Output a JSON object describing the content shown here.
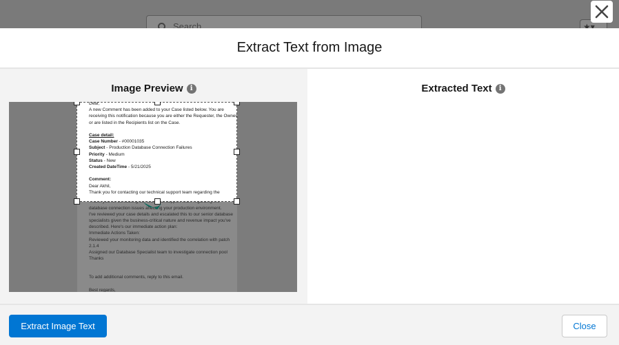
{
  "background": {
    "search_placeholder": "Search",
    "favorites_glyph": "★▾"
  },
  "modal": {
    "title": "Extract Text from Image",
    "close_icon": "close-icon",
    "left_pane": {
      "title": "Image Preview"
    },
    "right_pane": {
      "title": "Extracted Text",
      "content": ""
    },
    "info_glyph": "i",
    "footer": {
      "extract_button": "Extract Image Text",
      "close_button": "Close"
    }
  },
  "document": {
    "lines": [
      "Dear,",
      "A new Comment has been added to your Case listed below. You are",
      "receiving this notification because you are either the Requester, the Owner,",
      "or are listed in the Recipients list on the Case.",
      "",
      "Case detail:",
      "Case Number - #00001035",
      "Subject - Production Database Connection Failures",
      "Priority - Medium",
      "Status - New",
      "Created DateTime - 5/21/2025",
      "",
      "Comment:",
      "Dear Akhil,",
      "Thank you for contacting our technical support team regarding the",
      "database connection issues affecting your production environment.",
      "I've reviewed your case details and escalated this to our senior database",
      "specialists given the business-critical nature and revenue impact you've",
      "described. Here's our immediate action plan:",
      "Immediate Actions Taken:",
      "Reviewed your monitoring data and identified the correlation with patch",
      "2.1.4",
      "Assigned our Database Specialist team to investigate connection pool",
      "Thanks",
      "",
      "",
      "To add additional comments, reply to this email.",
      "",
      "Best regards,",
      "-"
    ]
  },
  "colors": {
    "primary": "#0176d3",
    "overlay": "#7a7a7a",
    "teal_accent": "#0b6b5d"
  }
}
